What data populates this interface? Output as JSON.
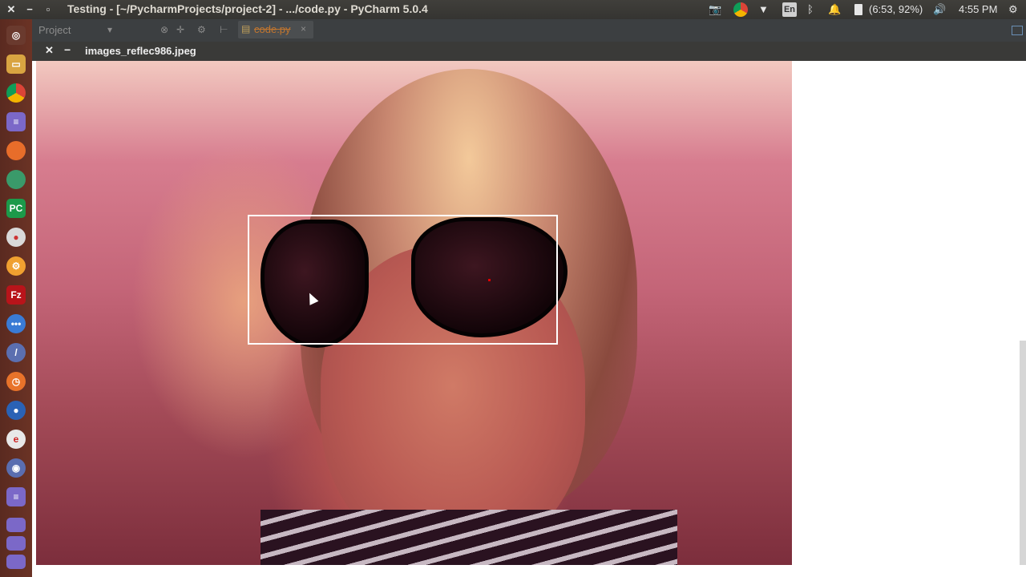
{
  "window": {
    "title": "Testing - [~/PycharmProjects/project-2] - .../code.py - PyCharm 5.0.4"
  },
  "tray": {
    "keyboard_layout": "En",
    "battery": "(6:53, 92%)",
    "clock": "4:55 PM"
  },
  "ide": {
    "project_label": "Project",
    "tab_label": "code.py"
  },
  "viewer": {
    "file_title": "images_reflec986.jpeg"
  },
  "colors": {
    "bbox": "#ffffff",
    "marker": "#e00000"
  },
  "launcher_icons": [
    "ubuntu-dash-icon",
    "files-icon",
    "chrome-icon",
    "text-editor-icon",
    "firefox-icon",
    "globe-icon",
    "pycharm-icon",
    "app-icon",
    "settings-icon",
    "filezilla-icon",
    "messaging-icon",
    "pen-icon",
    "clock-icon",
    "app-icon",
    "e-icon",
    "camera-icon",
    "document-icon"
  ]
}
